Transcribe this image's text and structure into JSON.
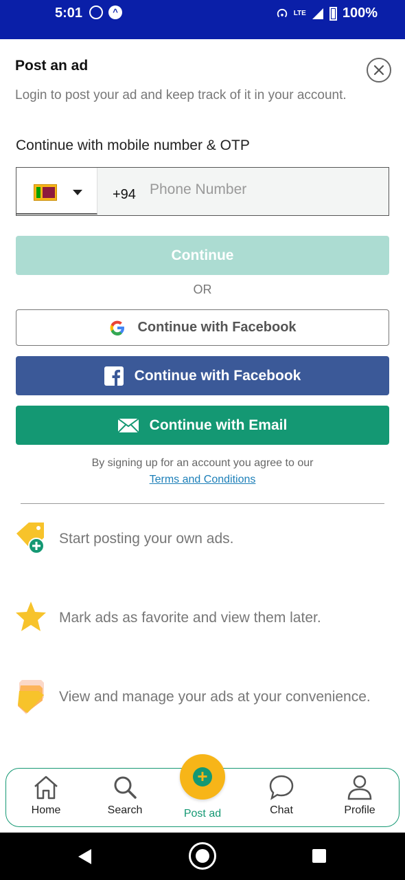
{
  "status_bar": {
    "time": "5:01",
    "battery": "100%",
    "network": "LTE"
  },
  "header": {
    "title": "Post an ad",
    "subtitle": "Login to post your ad and keep track of it in your account."
  },
  "mobile_section": {
    "label": "Continue with mobile number & OTP",
    "country_flag": "sri-lanka-flag",
    "dial_code": "+94",
    "phone_placeholder": "Phone Number",
    "phone_value": ""
  },
  "buttons": {
    "continue": "Continue",
    "or": "OR",
    "google": "Continue with Facebook",
    "facebook": "Continue with Facebook",
    "email": "Continue with Email"
  },
  "legal": {
    "agree_text": "By signing up for an account you agree to our",
    "terms_link": "Terms and Conditions"
  },
  "features": [
    {
      "icon": "tag-plus-icon",
      "text": "Start posting your own ads."
    },
    {
      "icon": "star-icon",
      "text": "Mark ads as favorite and view them later."
    },
    {
      "icon": "stack-icon",
      "text": "View and manage your ads at your convenience."
    }
  ],
  "bottom_nav": {
    "home": "Home",
    "search": "Search",
    "post_ad": "Post ad",
    "chat": "Chat",
    "profile": "Profile"
  },
  "colors": {
    "status_bar": "#0a1fa8",
    "primary_green": "#149873",
    "continue_disabled": "#acdcd2",
    "facebook_blue": "#3b5998",
    "accent_yellow": "#f7b518",
    "link_blue": "#1c7fb8"
  }
}
